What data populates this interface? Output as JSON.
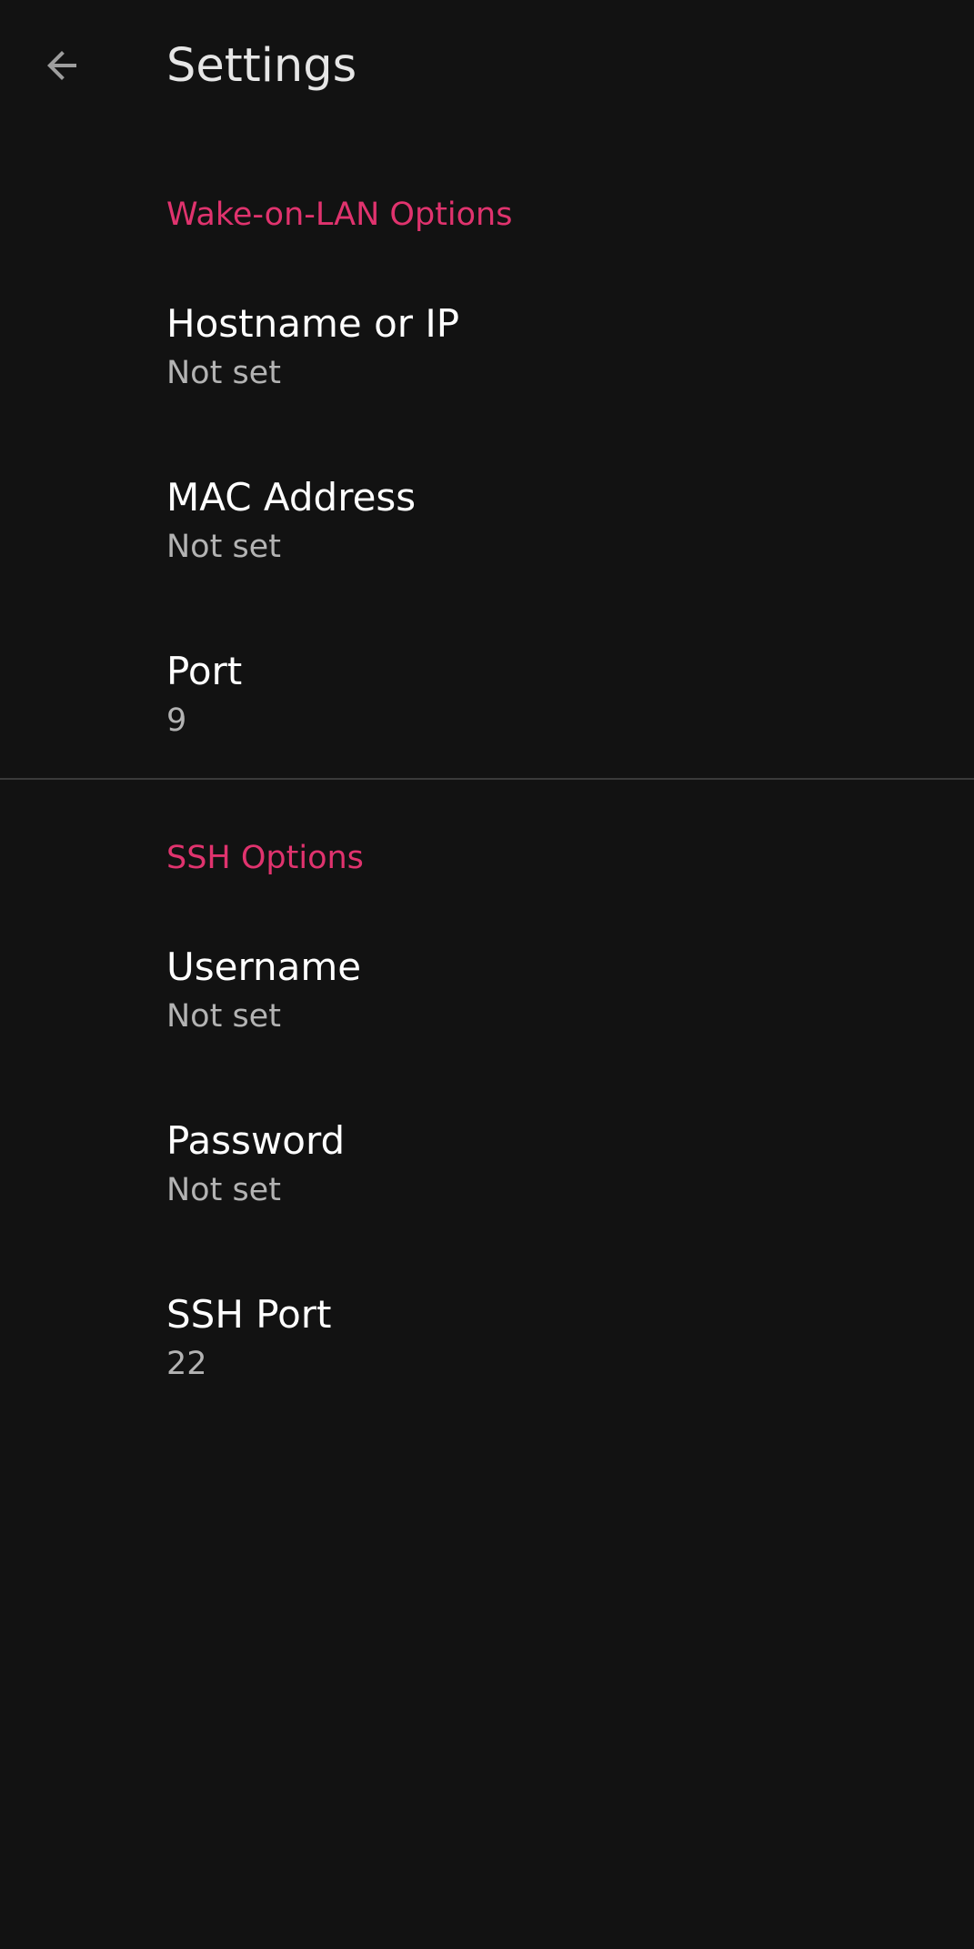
{
  "app_bar": {
    "title": "Settings",
    "back_icon": "arrow-back-icon"
  },
  "sections": [
    {
      "header": "Wake-on-LAN Options",
      "items": [
        {
          "title": "Hostname or IP",
          "summary": "Not set"
        },
        {
          "title": "MAC Address",
          "summary": "Not set"
        },
        {
          "title": "Port",
          "summary": "9"
        }
      ]
    },
    {
      "header": "SSH Options",
      "items": [
        {
          "title": "Username",
          "summary": "Not set"
        },
        {
          "title": "Password",
          "summary": "Not set"
        },
        {
          "title": "SSH Port",
          "summary": "22"
        }
      ]
    }
  ],
  "colors": {
    "background": "#121212",
    "accent": "#e0336e",
    "title_text": "#ffffff",
    "summary_text": "#b3b3b3",
    "divider": "#3a3a3a"
  }
}
